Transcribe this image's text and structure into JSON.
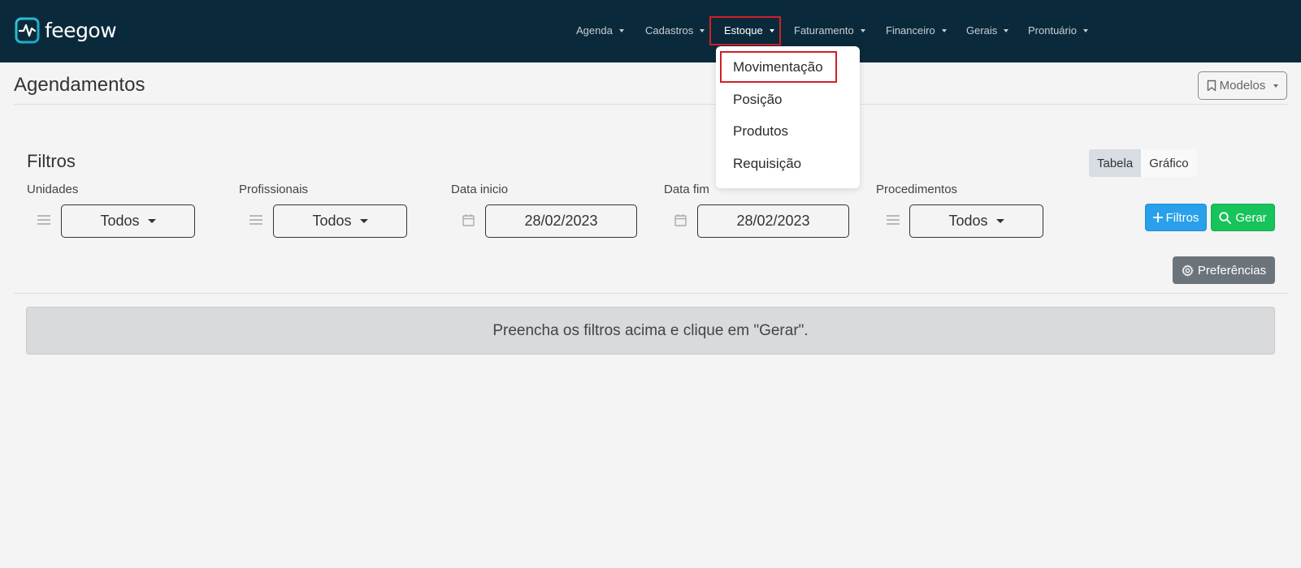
{
  "app": {
    "brand": "feegow",
    "brand_color": "#1fb7c9",
    "navbar_color": "#0a2a3b"
  },
  "nav": {
    "items": [
      {
        "label": "Agenda"
      },
      {
        "label": "Cadastros"
      },
      {
        "label": "Estoque",
        "active": true
      },
      {
        "label": "Faturamento"
      },
      {
        "label": "Financeiro"
      },
      {
        "label": "Gerais"
      },
      {
        "label": "Prontuário"
      }
    ]
  },
  "dropdown": {
    "items": [
      {
        "label": "Movimentação",
        "highlighted": true
      },
      {
        "label": "Posição"
      },
      {
        "label": "Produtos"
      },
      {
        "label": "Requisição"
      }
    ]
  },
  "page": {
    "title": "Agendamentos",
    "modelos_label": "Modelos",
    "modelos_icon": "bookmark-icon"
  },
  "filters": {
    "title": "Filtros",
    "view_toggle": [
      {
        "label": "Tabela",
        "selected": true
      },
      {
        "label": "Gráfico",
        "selected": false
      }
    ],
    "fields": [
      {
        "label": "Unidades",
        "value": "Todos",
        "icon": "drag-handle-icon"
      },
      {
        "label": "Profissionais",
        "value": "Todos",
        "icon": "drag-handle-icon"
      },
      {
        "label": "Data inicio",
        "value": "28/02/2023",
        "icon": "calendar-icon"
      },
      {
        "label": "Data fim",
        "value": "28/02/2023",
        "icon": "calendar-icon"
      },
      {
        "label": "Procedimentos",
        "value": "Todos",
        "icon": "drag-handle-icon"
      }
    ],
    "more_filters_label": "Filtros",
    "generate_label": "Gerar",
    "preferences_label": "Preferências"
  },
  "empty_state": {
    "message": "Preencha os filtros acima e clique em \"Gerar\"."
  },
  "colors": {
    "primary": "#2aa0ea",
    "success": "#17c35b",
    "secondary": "#6c747b",
    "highlight_border": "#d21f26"
  }
}
